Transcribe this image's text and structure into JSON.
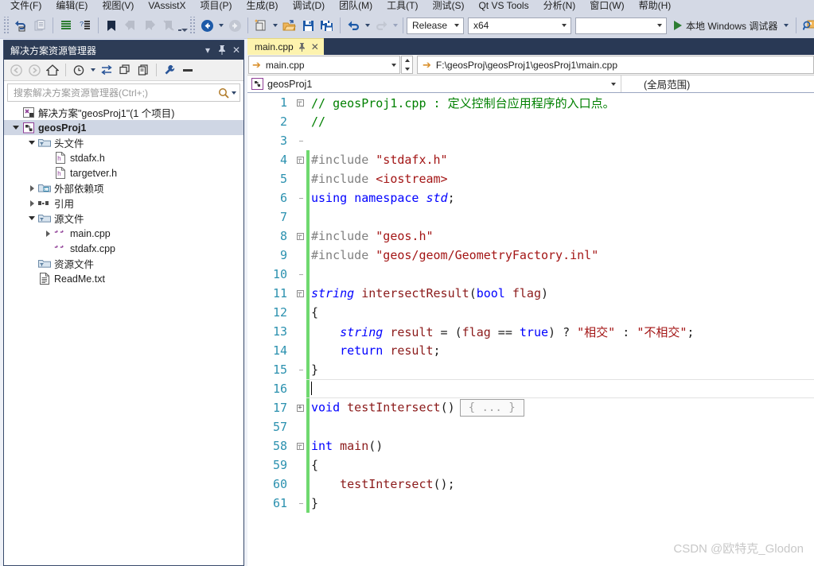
{
  "menubar": {
    "items": [
      {
        "label": "文件(F)"
      },
      {
        "label": "编辑(E)"
      },
      {
        "label": "视图(V)"
      },
      {
        "label": "VAssistX"
      },
      {
        "label": "项目(P)"
      },
      {
        "label": "生成(B)"
      },
      {
        "label": "调试(D)"
      },
      {
        "label": "团队(M)"
      },
      {
        "label": "工具(T)"
      },
      {
        "label": "测试(S)"
      },
      {
        "label": "Qt VS Tools"
      },
      {
        "label": "分析(N)"
      },
      {
        "label": "窗口(W)"
      },
      {
        "label": "帮助(H)"
      }
    ]
  },
  "toolbar": {
    "configuration": "Release",
    "platform": "x64",
    "blank_combo": "",
    "run_label": "本地 Windows 调试器",
    "icons": [
      "navigate-backward-icon",
      "navigate-forward-icon",
      "new-project-icon",
      "open-file-icon",
      "save-icon",
      "save-all-icon",
      "undo-icon",
      "redo-icon",
      "start-debug-icon",
      "find-in-files-icon"
    ]
  },
  "solution_explorer": {
    "title": "解决方案资源管理器",
    "search_placeholder": "搜索解决方案资源管理器(Ctrl+;)",
    "search_value": "",
    "tree": [
      {
        "label": "解决方案\"geosProj1\"(1 个项目)",
        "indent": 0,
        "twist": "none",
        "icon": "solution-icon",
        "selected": false
      },
      {
        "label": "geosProj1",
        "indent": 0,
        "twist": "expanded",
        "icon": "project-icon",
        "selected": true
      },
      {
        "label": "头文件",
        "indent": 1,
        "twist": "expanded",
        "icon": "folder-filter-icon",
        "selected": false
      },
      {
        "label": "stdafx.h",
        "indent": 2,
        "twist": "none",
        "icon": "header-file-icon",
        "selected": false
      },
      {
        "label": "targetver.h",
        "indent": 2,
        "twist": "none",
        "icon": "header-file-icon",
        "selected": false
      },
      {
        "label": "外部依赖项",
        "indent": 1,
        "twist": "collapsed",
        "icon": "folder-ext-icon",
        "selected": false
      },
      {
        "label": "引用",
        "indent": 1,
        "twist": "collapsed",
        "icon": "references-icon",
        "selected": false
      },
      {
        "label": "源文件",
        "indent": 1,
        "twist": "expanded",
        "icon": "folder-filter-icon",
        "selected": false
      },
      {
        "label": "main.cpp",
        "indent": 2,
        "twist": "collapsed",
        "icon": "cpp-file-icon",
        "selected": false
      },
      {
        "label": "stdafx.cpp",
        "indent": 2,
        "twist": "none",
        "icon": "cpp-file-icon",
        "selected": false
      },
      {
        "label": "资源文件",
        "indent": 1,
        "twist": "none",
        "icon": "folder-filter-icon",
        "selected": false
      },
      {
        "label": "ReadMe.txt",
        "indent": 1,
        "twist": "none",
        "icon": "text-file-icon",
        "selected": false
      }
    ]
  },
  "editor": {
    "tab": {
      "label": "main.cpp",
      "pin": "⇥",
      "close": "✕"
    },
    "nav_file": "main.cpp",
    "nav_path": "F:\\geosProj\\geosProj1\\geosProj1\\main.cpp",
    "dropdown_project": "geosProj1",
    "dropdown_scope": "(全局范围)",
    "lines": [
      {
        "num": "1",
        "fold": "start-minus",
        "bar": "none",
        "tokens": [
          {
            "t": "// geosProj1.cpp : 定义控制台应用程序的入口点。",
            "c": "cm"
          }
        ],
        "indent": 0
      },
      {
        "num": "2",
        "fold": "mid",
        "bar": "none",
        "tokens": [
          {
            "t": "//",
            "c": "cm"
          }
        ],
        "indent": 0
      },
      {
        "num": "3",
        "fold": "end",
        "bar": "none",
        "tokens": [],
        "indent": 0
      },
      {
        "num": "4",
        "fold": "start-minus",
        "bar": "green",
        "tokens": [
          {
            "t": "#include ",
            "c": "pp"
          },
          {
            "t": "\"stdafx.h\"",
            "c": "st"
          }
        ],
        "indent": 0
      },
      {
        "num": "5",
        "fold": "mid",
        "bar": "green",
        "tokens": [
          {
            "t": "#include ",
            "c": "pp"
          },
          {
            "t": "<iostream>",
            "c": "st"
          }
        ],
        "indent": 0
      },
      {
        "num": "6",
        "fold": "end",
        "bar": "green",
        "tokens": [
          {
            "t": "using",
            "c": "k"
          },
          {
            "t": " ",
            "c": "pl"
          },
          {
            "t": "namespace",
            "c": "k"
          },
          {
            "t": " ",
            "c": "pl"
          },
          {
            "t": "std",
            "c": "kt"
          },
          {
            "t": ";",
            "c": "pl"
          }
        ],
        "indent": 0
      },
      {
        "num": "7",
        "fold": "none",
        "bar": "green",
        "tokens": [],
        "indent": 0
      },
      {
        "num": "8",
        "fold": "start-minus",
        "bar": "green",
        "tokens": [
          {
            "t": "#include ",
            "c": "pp"
          },
          {
            "t": "\"geos.h\"",
            "c": "st"
          }
        ],
        "indent": 0
      },
      {
        "num": "9",
        "fold": "mid",
        "bar": "green",
        "tokens": [
          {
            "t": "#include ",
            "c": "pp"
          },
          {
            "t": "\"geos/geom/GeometryFactory.inl\"",
            "c": "st"
          }
        ],
        "indent": 0
      },
      {
        "num": "10",
        "fold": "end",
        "bar": "green",
        "tokens": [],
        "indent": 0
      },
      {
        "num": "11",
        "fold": "start-minus",
        "bar": "green",
        "tokens": [
          {
            "t": "string",
            "c": "kt"
          },
          {
            "t": " ",
            "c": "pl"
          },
          {
            "t": "intersectResult",
            "c": "id"
          },
          {
            "t": "(",
            "c": "pl"
          },
          {
            "t": "bool",
            "c": "k"
          },
          {
            "t": " ",
            "c": "pl"
          },
          {
            "t": "flag",
            "c": "id"
          },
          {
            "t": ")",
            "c": "pl"
          }
        ],
        "indent": 0
      },
      {
        "num": "12",
        "fold": "mid",
        "bar": "green",
        "tokens": [
          {
            "t": "{",
            "c": "pl"
          }
        ],
        "indent": 0
      },
      {
        "num": "13",
        "fold": "mid",
        "bar": "green",
        "tokens": [
          {
            "t": "    ",
            "c": "pl"
          },
          {
            "t": "string",
            "c": "kt"
          },
          {
            "t": " ",
            "c": "pl"
          },
          {
            "t": "result",
            "c": "id"
          },
          {
            "t": " = (",
            "c": "pl"
          },
          {
            "t": "flag",
            "c": "id"
          },
          {
            "t": " == ",
            "c": "pl"
          },
          {
            "t": "true",
            "c": "k"
          },
          {
            "t": ") ? ",
            "c": "pl"
          },
          {
            "t": "\"相交\"",
            "c": "st"
          },
          {
            "t": " : ",
            "c": "pl"
          },
          {
            "t": "\"不相交\"",
            "c": "st"
          },
          {
            "t": ";",
            "c": "pl"
          }
        ],
        "indent": 0
      },
      {
        "num": "14",
        "fold": "mid",
        "bar": "green",
        "tokens": [
          {
            "t": "    ",
            "c": "pl"
          },
          {
            "t": "return",
            "c": "k"
          },
          {
            "t": " ",
            "c": "pl"
          },
          {
            "t": "result",
            "c": "id"
          },
          {
            "t": ";",
            "c": "pl"
          }
        ],
        "indent": 0
      },
      {
        "num": "15",
        "fold": "end",
        "bar": "green",
        "tokens": [
          {
            "t": "}",
            "c": "pl"
          }
        ],
        "indent": 0
      },
      {
        "num": "16",
        "fold": "none",
        "bar": "green",
        "tokens": [],
        "indent": 0,
        "current": true
      },
      {
        "num": "17",
        "fold": "start-plus",
        "bar": "green",
        "tokens": [
          {
            "t": "void",
            "c": "k"
          },
          {
            "t": " ",
            "c": "pl"
          },
          {
            "t": "testIntersect",
            "c": "id"
          },
          {
            "t": "()",
            "c": "pl"
          }
        ],
        "indent": 0,
        "collapsed_box": "{ ... }"
      },
      {
        "num": "57",
        "fold": "none",
        "bar": "green",
        "tokens": [],
        "indent": 0
      },
      {
        "num": "58",
        "fold": "start-minus",
        "bar": "green",
        "tokens": [
          {
            "t": "int",
            "c": "k"
          },
          {
            "t": " ",
            "c": "pl"
          },
          {
            "t": "main",
            "c": "id"
          },
          {
            "t": "()",
            "c": "pl"
          }
        ],
        "indent": 0
      },
      {
        "num": "59",
        "fold": "mid",
        "bar": "green",
        "tokens": [
          {
            "t": "{",
            "c": "pl"
          }
        ],
        "indent": 0
      },
      {
        "num": "60",
        "fold": "mid",
        "bar": "green",
        "tokens": [
          {
            "t": "    ",
            "c": "pl"
          },
          {
            "t": "testIntersect",
            "c": "id"
          },
          {
            "t": "();",
            "c": "pl"
          }
        ],
        "indent": 0
      },
      {
        "num": "61",
        "fold": "end",
        "bar": "green",
        "tokens": [
          {
            "t": "}",
            "c": "pl"
          }
        ],
        "indent": 0
      }
    ]
  },
  "watermark": "CSDN @欧特克_Glodon",
  "colors": {
    "menubar_bg": "#d4d9e5",
    "chrome_bg": "#293955",
    "active_tab": "#fdf3ae",
    "panel_title": "#2d3c56",
    "comment": "#008000",
    "string": "#a31515",
    "keyword": "#0000ff",
    "linenum": "#2b91af",
    "changebar": "#6fd96f"
  }
}
